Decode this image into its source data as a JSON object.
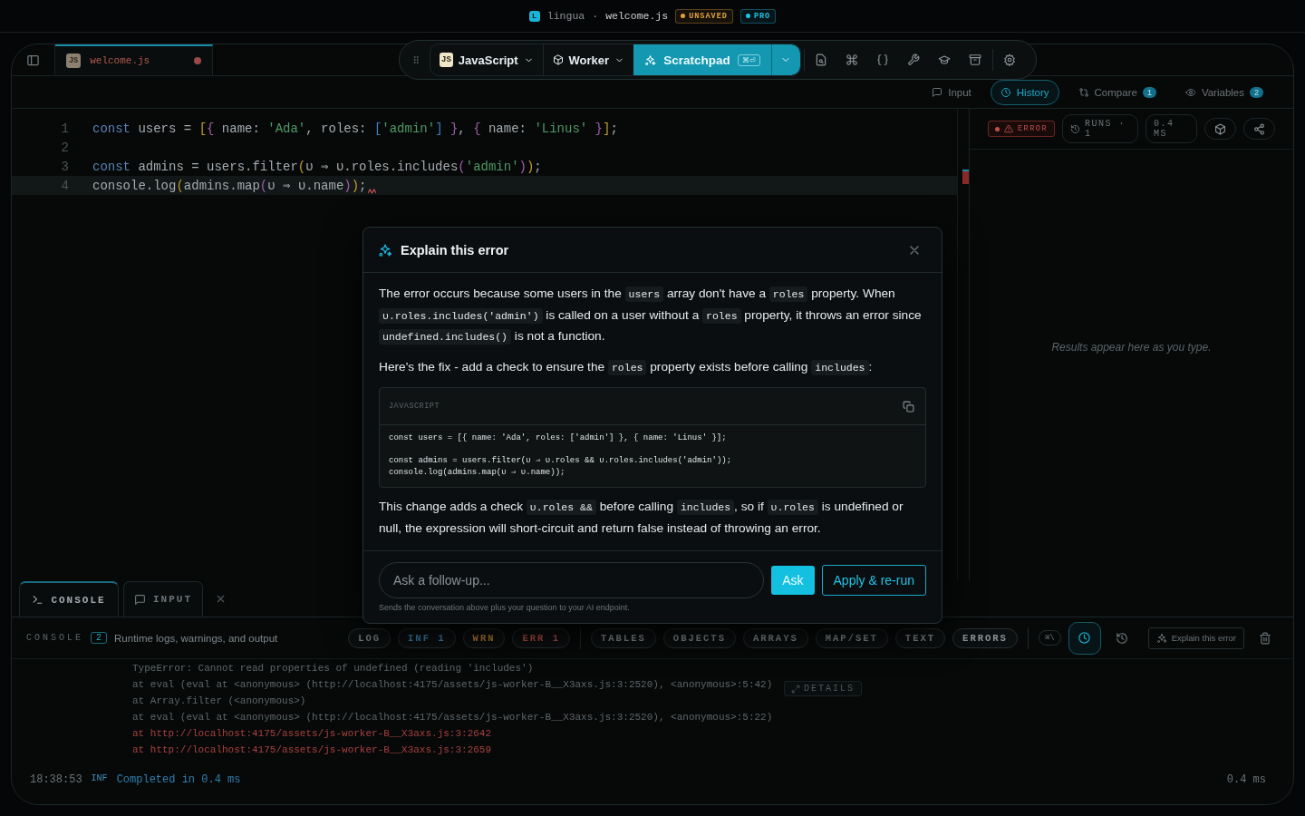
{
  "title_bar": {
    "logo_letter": "L",
    "app": "lingua",
    "separator": "·",
    "file": "welcome.js",
    "badges": [
      {
        "label": "UNSAVED",
        "color": "#e3a23b"
      },
      {
        "label": "PRO",
        "color": "#22c3e6"
      }
    ]
  },
  "editor_tabs": [
    {
      "icon": "JS",
      "label": "welcome.js",
      "selected": true,
      "modified": true
    }
  ],
  "toolbar": {
    "language": {
      "icon": "JS",
      "label": "JavaScript"
    },
    "runtime": {
      "label": "Worker"
    },
    "run_button": {
      "label": "Scratchpad",
      "shortcut": "⌘⏎"
    }
  },
  "side_tabs": [
    {
      "label": "Input",
      "kind": "input",
      "selected": false
    },
    {
      "label": "History",
      "kind": "history",
      "selected": true
    },
    {
      "label": "Compare",
      "kind": "compare",
      "count": "1",
      "selected": false
    },
    {
      "label": "Variables",
      "kind": "variables",
      "count": "2",
      "selected": false
    }
  ],
  "code_lines": [
    {
      "number": "1",
      "current": false,
      "error": false,
      "tokens": [
        {
          "text": "const",
          "kind": "keyword"
        },
        {
          "text": " users = ",
          "kind": "plain"
        },
        {
          "text": "[",
          "kind": "bracket1"
        },
        {
          "text": "{",
          "kind": "bracket2"
        },
        {
          "text": " name: ",
          "kind": "plain"
        },
        {
          "text": "'Ada'",
          "kind": "string"
        },
        {
          "text": ", roles: ",
          "kind": "plain"
        },
        {
          "text": "[",
          "kind": "bracket3"
        },
        {
          "text": "'admin'",
          "kind": "string"
        },
        {
          "text": "]",
          "kind": "bracket3"
        },
        {
          "text": " }",
          "kind": "bracket2"
        },
        {
          "text": ", ",
          "kind": "plain"
        },
        {
          "text": "{",
          "kind": "bracket2"
        },
        {
          "text": " name: ",
          "kind": "plain"
        },
        {
          "text": "'Linus'",
          "kind": "string"
        },
        {
          "text": " }",
          "kind": "bracket2"
        },
        {
          "text": "]",
          "kind": "bracket1"
        },
        {
          "text": ";",
          "kind": "plain"
        }
      ]
    },
    {
      "number": "2",
      "current": false,
      "error": false
    },
    {
      "number": "3",
      "current": false,
      "error": false,
      "tokens": [
        {
          "text": "const",
          "kind": "keyword"
        },
        {
          "text": " admins = users.filter",
          "kind": "plain"
        },
        {
          "text": "(",
          "kind": "bracket1"
        },
        {
          "text": "υ ⇒ υ.roles.includes",
          "kind": "plain"
        },
        {
          "text": "(",
          "kind": "bracket2"
        },
        {
          "text": "'admin'",
          "kind": "string"
        },
        {
          "text": ")",
          "kind": "bracket2"
        },
        {
          "text": ")",
          "kind": "bracket1"
        },
        {
          "text": ";",
          "kind": "plain"
        }
      ]
    },
    {
      "number": "4",
      "current": true,
      "error": true,
      "tokens": [
        {
          "text": "console.log",
          "kind": "plain"
        },
        {
          "text": "(",
          "kind": "bracket1"
        },
        {
          "text": "admins.map",
          "kind": "plain"
        },
        {
          "text": "(",
          "kind": "bracket2"
        },
        {
          "text": "υ ⇒ υ.name",
          "kind": "plain"
        },
        {
          "text": ")",
          "kind": "bracket2"
        },
        {
          "text": ")",
          "kind": "bracket1"
        },
        {
          "text": ";",
          "kind": "plain"
        }
      ]
    }
  ],
  "results": {
    "status": "ERROR",
    "runs": "RUNS · 1",
    "duration": "0.4 MS",
    "empty_message": "Results appear here as you type."
  },
  "console_tabs": [
    {
      "label": "CONSOLE",
      "kind": "console",
      "selected": true
    },
    {
      "label": "INPUT",
      "kind": "input",
      "selected": false
    }
  ],
  "console": {
    "title": "CONSOLE",
    "count": "2",
    "description": "Runtime logs, warnings, and output",
    "filters": [
      {
        "label": "LOG",
        "kind": "log"
      },
      {
        "label": "INF",
        "count": "1",
        "kind": "info"
      },
      {
        "label": "WRN",
        "kind": "warn"
      },
      {
        "label": "ERR",
        "count": "1",
        "kind": "error"
      },
      {
        "label": "TABLES",
        "kind": "type"
      },
      {
        "label": "OBJECTS",
        "kind": "type"
      },
      {
        "label": "ARRAYS",
        "kind": "type"
      },
      {
        "label": "MAP/SET",
        "kind": "type"
      },
      {
        "label": "TEXT",
        "kind": "type"
      },
      {
        "label": "ERRORS",
        "kind": "type"
      }
    ],
    "shortcut": "⌘\\",
    "timestamps_selected": true,
    "explain_button": "Explain this error",
    "details_button": "DETAILS",
    "log_lines": [
      {
        "text": "TypeError: Cannot read properties of undefined (reading 'includes')",
        "kind": "trace"
      },
      {
        "text": "at eval (eval at <anonymous> (http://localhost:4175/assets/js-worker-B__X3axs.js:3:2520), <anonymous>:5:42)",
        "kind": "trace"
      },
      {
        "text": "at Array.filter (<anonymous>)",
        "kind": "trace"
      },
      {
        "text": "at eval (eval at <anonymous> (http://localhost:4175/assets/js-worker-B__X3axs.js:3:2520), <anonymous>:5:22)",
        "kind": "trace"
      },
      {
        "text": "at http://localhost:4175/assets/js-worker-B__X3axs.js:3:2642",
        "kind": "error"
      },
      {
        "text": "at http://localhost:4175/assets/js-worker-B__X3axs.js:3:2659",
        "kind": "error"
      }
    ],
    "entries": [
      {
        "time": "18:38:53",
        "level": "INF",
        "message": "Completed in 0.4 ms",
        "duration": "0.4 ms"
      }
    ]
  },
  "dialog": {
    "title": "Explain this error",
    "blocks": [
      {
        "kind": "text",
        "segments": [
          {
            "text": "The error occurs because some users in the ",
            "code": false
          },
          {
            "text": "users",
            "code": true
          },
          {
            "text": " array don't have a ",
            "code": false
          },
          {
            "text": "roles",
            "code": true
          },
          {
            "text": " property. When ",
            "code": false
          },
          {
            "text": "υ.roles.includes('admin')",
            "code": true
          },
          {
            "text": " is called on a user without a ",
            "code": false
          },
          {
            "text": "roles",
            "code": true
          },
          {
            "text": " property, it throws an error since ",
            "code": false
          },
          {
            "text": "undefined.includes()",
            "code": true
          },
          {
            "text": " is not a function.",
            "code": false
          }
        ]
      },
      {
        "kind": "text",
        "segments": [
          {
            "text": "Here's the fix - add a check to ensure the ",
            "code": false
          },
          {
            "text": "roles",
            "code": true
          },
          {
            "text": " property exists before calling ",
            "code": false
          },
          {
            "text": "includes",
            "code": true
          },
          {
            "text": ":",
            "code": false
          }
        ]
      },
      {
        "kind": "code",
        "language": "JAVASCRIPT",
        "code": "const users = [{ name: 'Ada', roles: ['admin'] }, { name: 'Linus' }];\n\nconst admins = users.filter(υ ⇒ υ.roles && υ.roles.includes('admin'));\nconsole.log(admins.map(υ ⇒ υ.name));"
      },
      {
        "kind": "text",
        "segments": [
          {
            "text": "This change adds a check ",
            "code": false
          },
          {
            "text": "υ.roles &&",
            "code": true
          },
          {
            "text": " before calling ",
            "code": false
          },
          {
            "text": "includes",
            "code": true
          },
          {
            "text": ", so if ",
            "code": false
          },
          {
            "text": "υ.roles",
            "code": true
          },
          {
            "text": " is undefined or null, the expression will short-circuit and return false instead of throwing an error.",
            "code": false
          }
        ]
      }
    ],
    "followup": {
      "placeholder": "Ask a follow-up...",
      "ask": "Ask",
      "apply": "Apply & re-run",
      "note": "Sends the conversation above plus your question to your AI endpoint."
    }
  }
}
